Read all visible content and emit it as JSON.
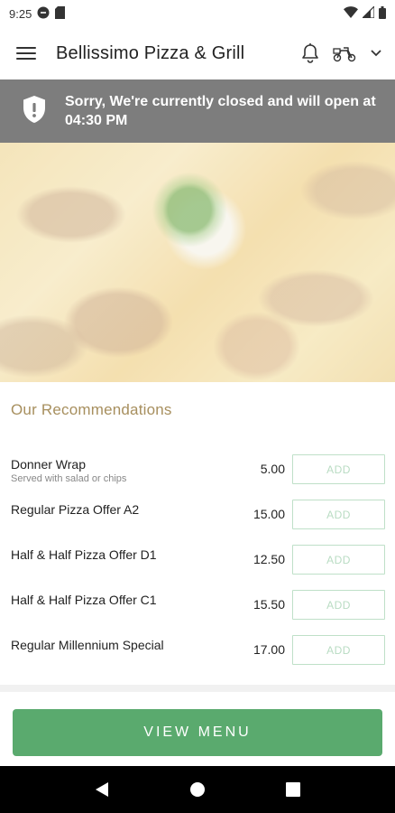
{
  "status_bar": {
    "time": "9:25",
    "left_icons": [
      "do-not-disturb-icon",
      "sd-card-icon"
    ],
    "right_icons": [
      "wifi-icon",
      "cell-signal-icon",
      "battery-icon"
    ]
  },
  "app_bar": {
    "title": "Bellissimo Pizza & Grill",
    "icons": [
      "menu-icon",
      "bell-icon",
      "scooter-icon",
      "chevron-down-icon"
    ]
  },
  "closed_banner": {
    "message": "Sorry, We're currently closed and will open at 04:30 PM",
    "icon": "shield-alert-icon"
  },
  "recommendations": {
    "heading": "Our Recommendations",
    "items": [
      {
        "name": "Donner Wrap",
        "description": "Served with salad or chips",
        "price": "5.00",
        "action": "ADD"
      },
      {
        "name": "Regular Pizza Offer A2",
        "description": "",
        "price": "15.00",
        "action": "ADD"
      },
      {
        "name": "Half & Half Pizza Offer D1",
        "description": "",
        "price": "12.50",
        "action": "ADD"
      },
      {
        "name": "Half & Half Pizza Offer C1",
        "description": "",
        "price": "15.50",
        "action": "ADD"
      },
      {
        "name": "Regular Millennium Special",
        "description": "",
        "price": "17.00",
        "action": "ADD"
      }
    ]
  },
  "view_menu_label": "VIEW MENU",
  "nav_bar": {
    "icons": [
      "back-icon",
      "home-icon",
      "recents-icon"
    ]
  },
  "colors": {
    "banner": "#7d7d7d",
    "heading": "#a78f5e",
    "primary_button": "#5aaa6e",
    "add_button_border": "#bfe0c8"
  }
}
